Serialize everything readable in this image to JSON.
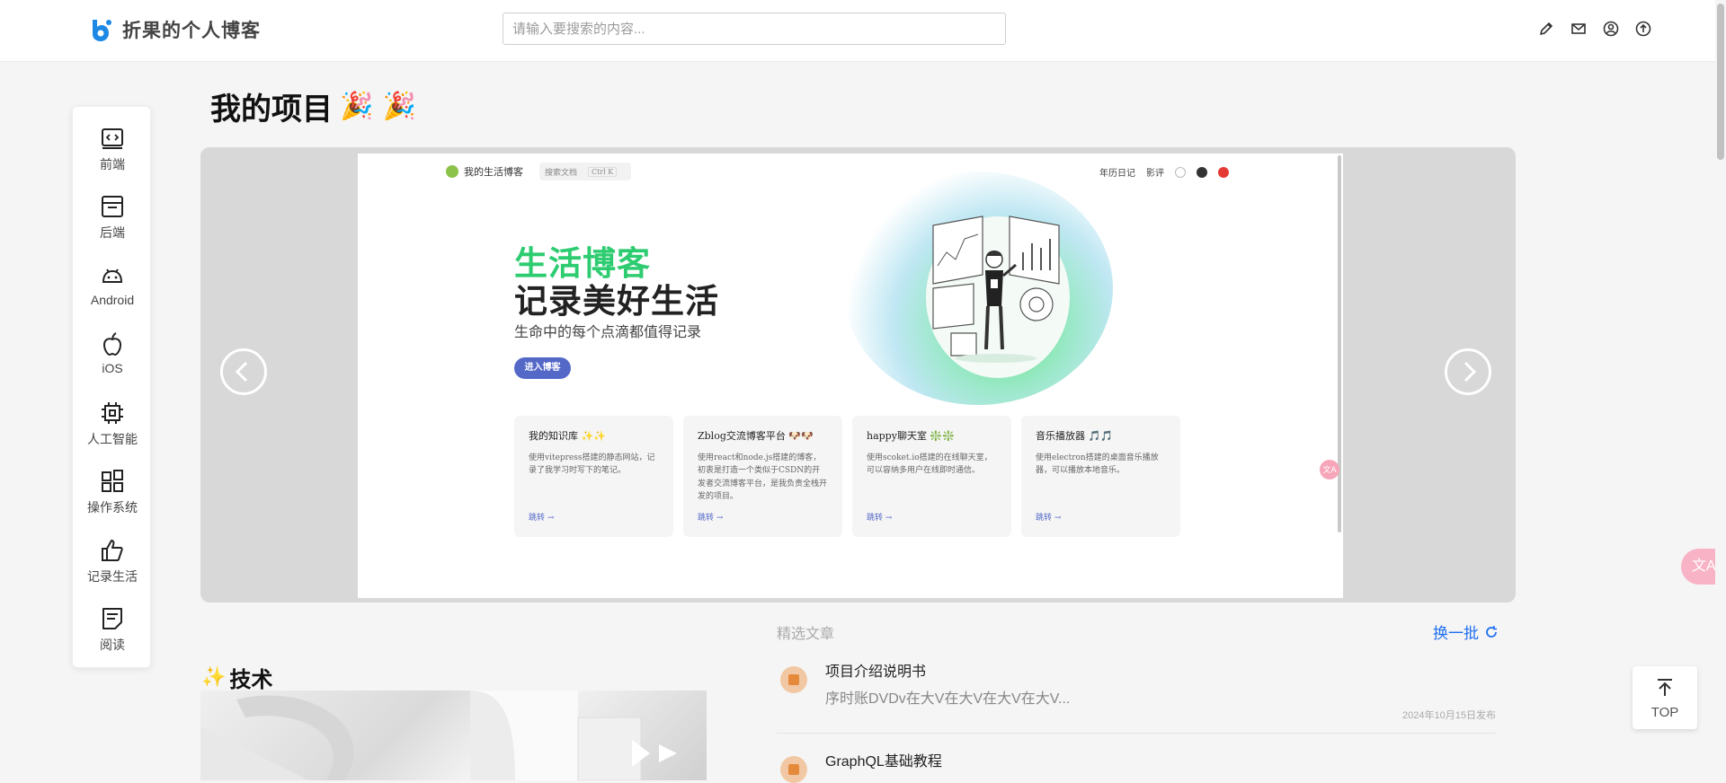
{
  "header": {
    "brand_name": "折果的个人博客",
    "search_placeholder": "请输入要搜索的内容...",
    "icons": [
      "pencil-icon",
      "mail-icon",
      "user-icon",
      "upload-icon"
    ]
  },
  "categories": [
    {
      "label": "前端",
      "icon": "code-icon"
    },
    {
      "label": "后端",
      "icon": "server-icon"
    },
    {
      "label": "Android",
      "icon": "android-icon"
    },
    {
      "label": "iOS",
      "icon": "apple-icon"
    },
    {
      "label": "人工智能",
      "icon": "chip-icon"
    },
    {
      "label": "操作系统",
      "icon": "windows-icon"
    },
    {
      "label": "记录生活",
      "icon": "thumbs-up-icon"
    },
    {
      "label": "阅读",
      "icon": "note-icon"
    }
  ],
  "projects": {
    "title": "我的项目",
    "title_emoji": "🎉 🎉",
    "slide": {
      "site_name": "我的生活博客",
      "search_text": "搜索文档",
      "search_kbd": "Ctrl K",
      "nav": [
        "年历日记",
        "影评"
      ],
      "hero_line1": "生活博客",
      "hero_line2": "记录美好生活",
      "hero_sub": "生命中的每个点滴都值得记录",
      "cta": "进入博客",
      "cards": [
        {
          "title": "我的知识库 ✨✨",
          "desc": "使用vitepress搭建的静态网站，记录了我学习时写下的笔记。",
          "link": "跳转 →"
        },
        {
          "title": "Zblog交流博客平台 🐶🐶",
          "desc": "使用react和node.js搭建的博客，初衷是打造一个类似于CSDN的开发者交流博客平台，是我负责全栈开发的项目。",
          "link": "跳转 →"
        },
        {
          "title": "happy聊天室 ❇️❇️",
          "desc": "使用scoket.io搭建的在线聊天室，可以容纳多用户在线即时通信。",
          "link": "跳转 →"
        },
        {
          "title": "音乐播放器 🎵🎵",
          "desc": "使用electron搭建的桌面音乐播放器，可以播放本地音乐。",
          "link": "跳转 →"
        }
      ],
      "translate_badge": "文A"
    }
  },
  "tech": {
    "title": "技术",
    "emoji": "✨"
  },
  "featured": {
    "heading": "精选文章",
    "refresh_label": "换一批",
    "articles": [
      {
        "title": "项目介绍说明书",
        "summary": "序时账DVDv在大V在大V在大V在大V...",
        "date": "2024年10月15日发布"
      },
      {
        "title": "GraphQL基础教程",
        "summary": "",
        "date": ""
      }
    ]
  },
  "floating": {
    "top_label": "TOP",
    "translate_icon": "文A"
  },
  "colors": {
    "accent_blue": "#1e6ff0",
    "hero_green": "#2ecc71",
    "cta_purple": "#5468c8"
  }
}
